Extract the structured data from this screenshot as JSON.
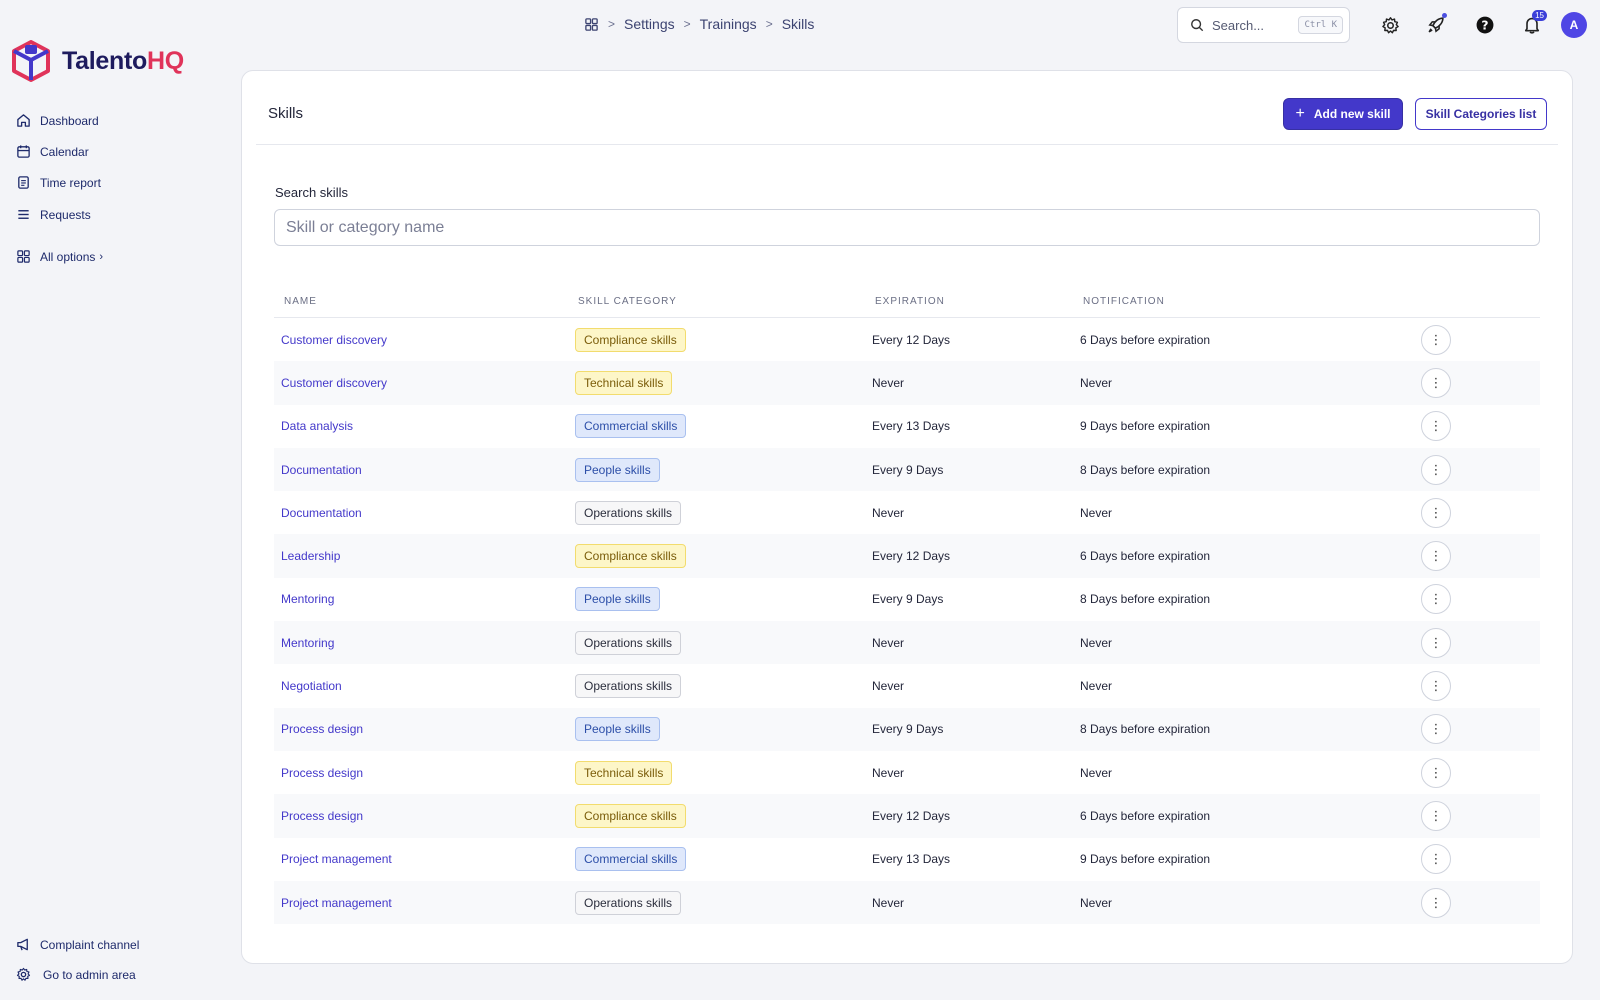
{
  "brand": {
    "part1": "Talento",
    "part2": "HQ",
    "color_primary": "#1e1b5e",
    "color_accent": "#e0335a"
  },
  "sidebar": {
    "items": [
      {
        "label": "Dashboard",
        "icon": "home-icon"
      },
      {
        "label": "Calendar",
        "icon": "calendar-icon"
      },
      {
        "label": "Time report",
        "icon": "document-icon"
      },
      {
        "label": "Requests",
        "icon": "list-icon"
      },
      {
        "label": "All options",
        "icon": "grid-icon"
      }
    ],
    "bottom": [
      {
        "label": "Complaint channel",
        "icon": "megaphone-icon"
      },
      {
        "label": "Go to admin area",
        "icon": "gear-icon"
      }
    ]
  },
  "breadcrumb": [
    "Settings",
    "Trainings",
    "Skills"
  ],
  "topbar": {
    "search_placeholder": "Search...",
    "search_shortcut": "Ctrl K",
    "notification_count": "15",
    "avatar_initial": "A"
  },
  "page": {
    "title": "Skills",
    "add_button": "Add new skill",
    "categories_button": "Skill Categories list",
    "search_label": "Search skills",
    "search_placeholder": "Skill or category name"
  },
  "table": {
    "columns": [
      "NAME",
      "SKILL CATEGORY",
      "EXPIRATION",
      "NOTIFICATION"
    ],
    "rows": [
      {
        "name": "Customer discovery",
        "category": "Compliance skills",
        "color": "yellow",
        "expiration": "Every 12 Days",
        "notification": "6 Days before expiration"
      },
      {
        "name": "Customer discovery",
        "category": "Technical skills",
        "color": "yellow",
        "expiration": "Never",
        "notification": "Never"
      },
      {
        "name": "Data analysis",
        "category": "Commercial skills",
        "color": "blue",
        "expiration": "Every 13 Days",
        "notification": "9 Days before expiration"
      },
      {
        "name": "Documentation",
        "category": "People skills",
        "color": "blue",
        "expiration": "Every 9 Days",
        "notification": "8 Days before expiration"
      },
      {
        "name": "Documentation",
        "category": "Operations skills",
        "color": "gray",
        "expiration": "Never",
        "notification": "Never"
      },
      {
        "name": "Leadership",
        "category": "Compliance skills",
        "color": "yellow",
        "expiration": "Every 12 Days",
        "notification": "6 Days before expiration"
      },
      {
        "name": "Mentoring",
        "category": "People skills",
        "color": "blue",
        "expiration": "Every 9 Days",
        "notification": "8 Days before expiration"
      },
      {
        "name": "Mentoring",
        "category": "Operations skills",
        "color": "gray",
        "expiration": "Never",
        "notification": "Never"
      },
      {
        "name": "Negotiation",
        "category": "Operations skills",
        "color": "gray",
        "expiration": "Never",
        "notification": "Never"
      },
      {
        "name": "Process design",
        "category": "People skills",
        "color": "blue",
        "expiration": "Every 9 Days",
        "notification": "8 Days before expiration"
      },
      {
        "name": "Process design",
        "category": "Technical skills",
        "color": "yellow",
        "expiration": "Never",
        "notification": "Never"
      },
      {
        "name": "Process design",
        "category": "Compliance skills",
        "color": "yellow",
        "expiration": "Every 12 Days",
        "notification": "6 Days before expiration"
      },
      {
        "name": "Project management",
        "category": "Commercial skills",
        "color": "blue",
        "expiration": "Every 13 Days",
        "notification": "9 Days before expiration"
      },
      {
        "name": "Project management",
        "category": "Operations skills",
        "color": "gray",
        "expiration": "Never",
        "notification": "Never"
      }
    ]
  }
}
